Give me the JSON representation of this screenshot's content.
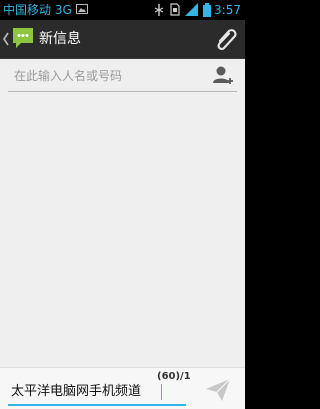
{
  "status_bar": {
    "carrier": "中国移动 3G",
    "time": "3:57",
    "icons": [
      "picture-icon",
      "usb-debug-icon",
      "sim-icon",
      "signal-icon",
      "battery-icon"
    ]
  },
  "action_bar": {
    "title": "新信息",
    "icons": [
      "back-chevron-icon",
      "messaging-app-icon",
      "attach-icon"
    ]
  },
  "recipient": {
    "placeholder": "在此输入人名或号码",
    "value": ""
  },
  "composer": {
    "message": "太平洋电脑网手机频道",
    "char_counter": "(60)/1",
    "send_icon": "send-icon"
  },
  "colors": {
    "accent": "#33b5e5",
    "app_icon_green": "#8cc63f",
    "action_bar_bg": "#2b2b2b",
    "content_bg": "#efefef"
  }
}
